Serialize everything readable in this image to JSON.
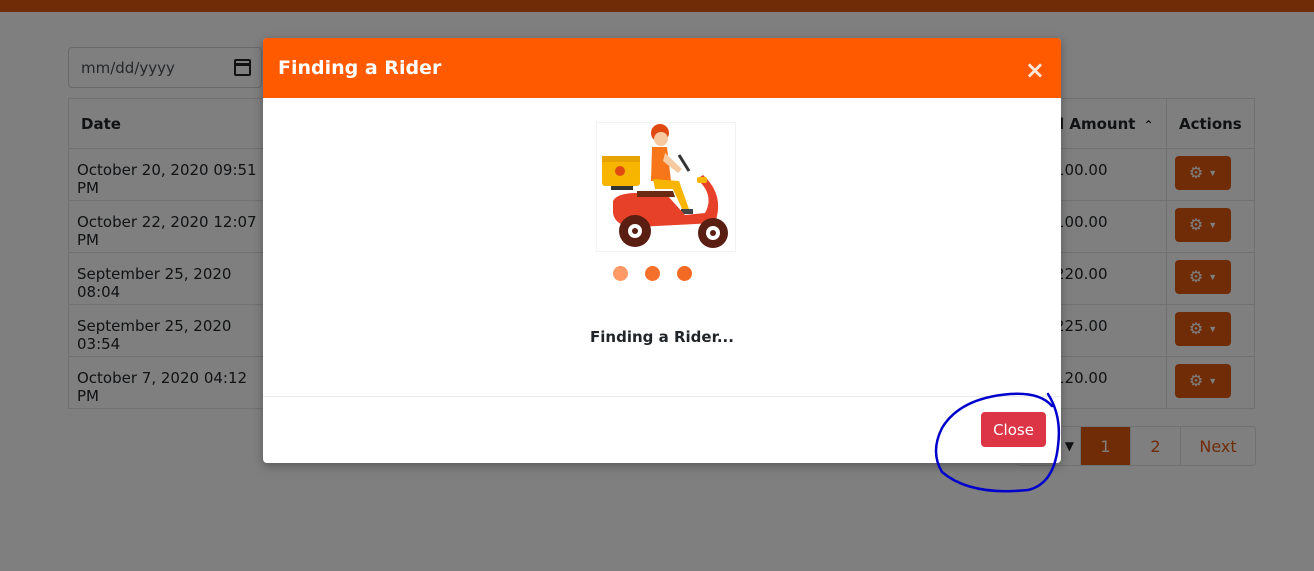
{
  "date_filter": {
    "placeholder": "mm/dd/yyyy"
  },
  "table": {
    "headers": {
      "date": "Date",
      "amount": "l Amount",
      "actions": "Actions"
    },
    "rows": [
      {
        "date": "October 20, 2020 09:51 PM",
        "amount": "100.00"
      },
      {
        "date": "October 22, 2020 12:07 PM",
        "amount": "100.00"
      },
      {
        "date": "September 25, 2020 08:04",
        "amount": "220.00"
      },
      {
        "date": "September 25, 2020 03:54",
        "amount": "225.00"
      },
      {
        "date": "October 7, 2020 04:12 PM",
        "amount": "120.00"
      }
    ]
  },
  "pagination": {
    "pages": [
      "1",
      "2"
    ],
    "active": "1",
    "next": "Next"
  },
  "modal": {
    "title": "Finding a Rider",
    "close_x": "×",
    "status": "Finding a Rider...",
    "close_button": "Close"
  },
  "colors": {
    "brand": "#ff5a00",
    "button": "#e0560f",
    "danger": "#dc3545",
    "annotation": "#0000cc"
  }
}
